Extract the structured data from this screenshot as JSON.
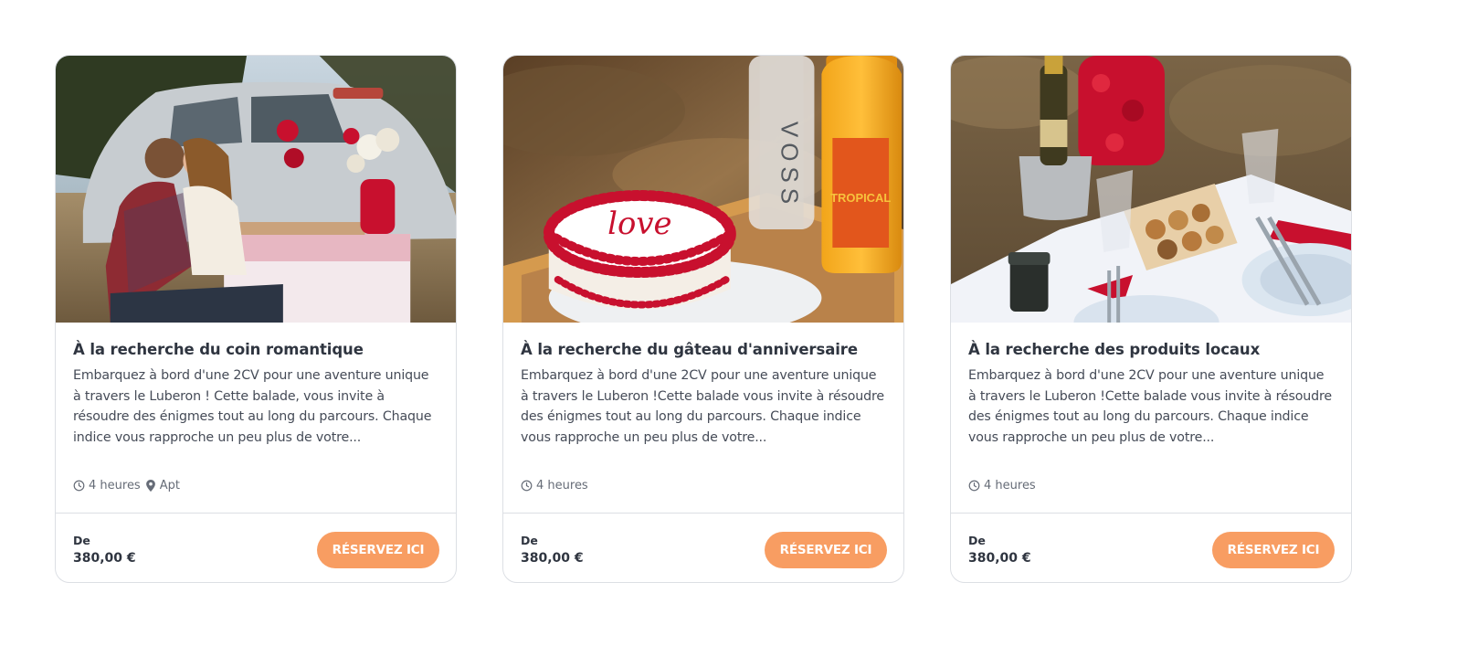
{
  "cards": [
    {
      "title": "À la recherche du coin romantique",
      "description": "Embarquez à bord d'une 2CV pour une aventure unique à travers le Luberon ! Cette balade, vous invite à résoudre des énigmes tout au long du parcours. Chaque indice vous rapproche un peu plus de votre...",
      "duration": "4 heures",
      "location": "Apt",
      "price_label": "De",
      "price": "380,00 €",
      "button_label": "RÉSERVEZ ICI",
      "image_subject": "couple-with-2cv-picnic"
    },
    {
      "title": "À la recherche du gâteau d'anniversaire",
      "description": "Embarquez à bord d'une 2CV pour une aventure unique à travers le Luberon !Cette balade vous invite à résoudre des énigmes tout au long du parcours. Chaque indice vous rapproche un peu plus de votre...",
      "duration": "4 heures",
      "price_label": "De",
      "price": "380,00 €",
      "button_label": "RÉSERVEZ ICI",
      "image_subject": "love-cake-and-drinks"
    },
    {
      "title": "À la recherche des produits locaux",
      "description": "Embarquez à bord d'une 2CV pour une aventure unique à travers le Luberon !Cette balade vous invite à résoudre des énigmes tout au long du parcours. Chaque indice vous rapproche un peu plus de votre...",
      "duration": "4 heures",
      "price_label": "De",
      "price": "380,00 €",
      "button_label": "RÉSERVEZ ICI",
      "image_subject": "picnic-table-local-products"
    }
  ],
  "image_text": {
    "bottle_brand": "VOSS",
    "juice_label": "TROPICAL",
    "cake_text": "love"
  },
  "colors": {
    "accent": "#f89d62",
    "title": "#2f3540",
    "text": "#454b57",
    "border": "#dcdfe4"
  },
  "icons": {
    "duration": "clock-icon",
    "location": "location-pin-icon"
  }
}
